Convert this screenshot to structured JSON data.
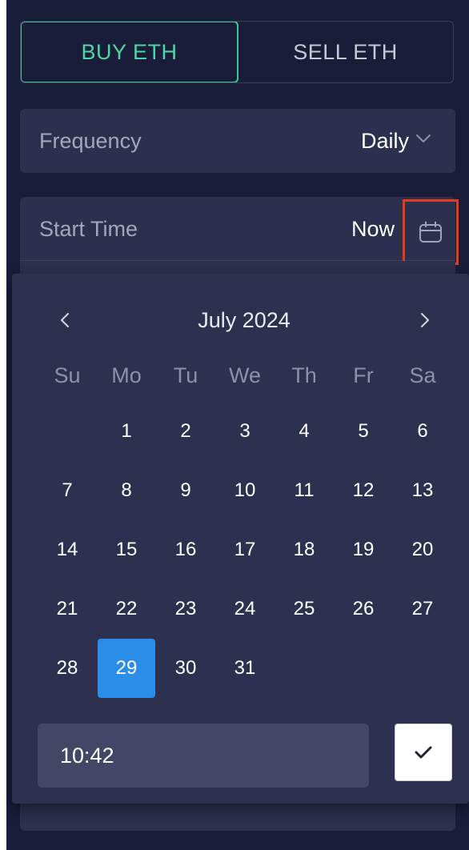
{
  "tabs": [
    {
      "label": "BUY ETH",
      "active": true
    },
    {
      "label": "SELL ETH",
      "active": false
    }
  ],
  "frequency": {
    "label": "Frequency",
    "value": "Daily",
    "icon": "chevron-down-icon"
  },
  "start_time": {
    "label": "Start Time",
    "value": "Now",
    "icon": "calendar-icon"
  },
  "calendar": {
    "month_title": "July 2024",
    "prev_icon": "chevron-left-icon",
    "next_icon": "chevron-right-icon",
    "weekdays": [
      "Su",
      "Mo",
      "Tu",
      "We",
      "Th",
      "Fr",
      "Sa"
    ],
    "weeks": [
      [
        "",
        "1",
        "2",
        "3",
        "4",
        "5",
        "6"
      ],
      [
        "7",
        "8",
        "9",
        "10",
        "11",
        "12",
        "13"
      ],
      [
        "14",
        "15",
        "16",
        "17",
        "18",
        "19",
        "20"
      ],
      [
        "21",
        "22",
        "23",
        "24",
        "25",
        "26",
        "27"
      ],
      [
        "28",
        "29",
        "30",
        "31",
        "",
        "",
        ""
      ]
    ],
    "selected_day": "29",
    "time_value": "10:42",
    "confirm_icon": "check-icon"
  },
  "colors": {
    "accent_green": "#41c594",
    "selected_blue": "#2a8ee9",
    "highlight_red": "#e53b1b",
    "panel_bg": "#1a1d3a"
  }
}
